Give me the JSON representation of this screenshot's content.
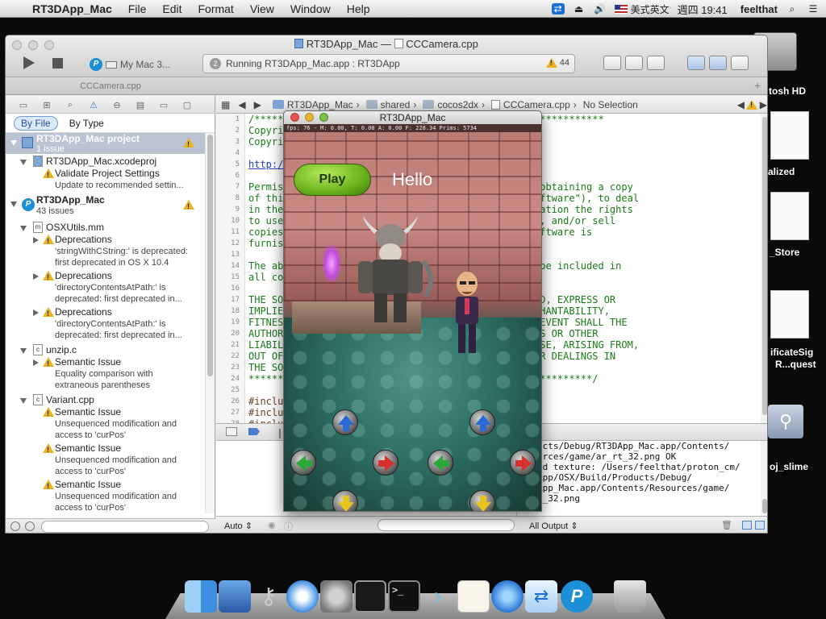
{
  "menubar": {
    "app_name": "RT3DApp_Mac",
    "menus": [
      "File",
      "Edit",
      "Format",
      "View",
      "Window",
      "Help"
    ],
    "input_method": "美式英文",
    "clock": "週四 19:41",
    "user": "feelthat"
  },
  "desktop": {
    "labels": [
      "tosh HD",
      "alized",
      "_Store",
      "ificateSig",
      "R...quest",
      "oj_slime"
    ]
  },
  "xcode": {
    "window_title": "RT3DApp_Mac",
    "window_title_sep": "—",
    "window_file": "CCCamera.cpp",
    "scheme": "My Mac 3...",
    "activity_text": "Running RT3DApp_Mac.app : RT3DApp",
    "activity_index": "2",
    "warning_count": "44",
    "tab_label": "CCCamera.cpp",
    "filter_by_file": "By File",
    "filter_by_type": "By Type",
    "jumpbar": {
      "project": "RT3DApp_Mac",
      "folder1": "shared",
      "folder2": "cocos2dx",
      "file": "CCCamera.cpp",
      "selection": "No Selection"
    },
    "issues": [
      {
        "title": "RT3DApp_Mac project",
        "sub": "1 issue"
      },
      {
        "title": "RT3DApp_Mac.xcodeproj"
      },
      {
        "title": "Validate Project Settings",
        "sub": "Update to recommended settin..."
      },
      {
        "title": "RT3DApp_Mac",
        "sub": "43 issues"
      },
      {
        "title": "OSXUtils.mm"
      },
      {
        "title": "Deprecations",
        "sub1": "'stringWithCString:' is deprecated:",
        "sub2": "first deprecated in OS X 10.4"
      },
      {
        "title": "Deprecations",
        "sub1": "'directoryContentsAtPath:' is",
        "sub2": "deprecated: first deprecated in..."
      },
      {
        "title": "Deprecations",
        "sub1": "'directoryContentsAtPath:' is",
        "sub2": "deprecated: first deprecated in..."
      },
      {
        "title": "unzip.c"
      },
      {
        "title": "Semantic Issue",
        "sub1": "Equality comparison with",
        "sub2": "extraneous parentheses"
      },
      {
        "title": "Variant.cpp"
      },
      {
        "title": "Semantic Issue",
        "sub1": "Unsequenced modification and",
        "sub2": "access to 'curPos'"
      },
      {
        "title": "Semantic Issue",
        "sub1": "Unsequenced modification and",
        "sub2": "access to 'curPos'"
      },
      {
        "title": "Semantic Issue",
        "sub1": "Unsequenced modification and",
        "sub2": "access to 'curPos'"
      }
    ],
    "line_numbers": [
      "1",
      "2",
      "3",
      "4",
      "5",
      "6",
      "7",
      "8",
      "9",
      "10",
      "11",
      "12",
      "13",
      "14",
      "15",
      "16",
      "17",
      "18",
      "19",
      "20",
      "21",
      "22",
      "23",
      "24",
      "25",
      "26",
      "27",
      "28"
    ],
    "code_lines": [
      "/************************************************************",
      "Copyri",
      "Copyri",
      "",
      "http:/",
      "",
      "Permis                                  ny person obtaining a copy",
      "of thi                                  s (the \"Software\"), to deal",
      "in the                                  hout limitation the rights",
      "to use                                  sublicense, and/or sell",
      "copies                                  hom the Software is",
      "furnis                                  tions:",
      "",
      "The ab                                  ice shall be included in",
      "all co",
      "",
      "THE SO                                  OF ANY KIND, EXPRESS OR",
      "IMPLIE                                  ES OF MERCHANTABILITY,",
      "FITNES                                  NT. IN NO EVENT SHALL THE",
      "AUTHOR                                  IM, DAMAGES OR OTHER",
      "LIABIL                                  OR OTHERWISE, ARISING FROM,",
      "OUT OF                                  SE OR OTHER DEALINGS IN",
      "THE SO",
      "***********************************************************/",
      "",
      "#inclu",
      "#inclu",
      "#inclu"
    ],
    "console_lines": [
      "ucts/Debug/RT3DApp_Mac.app/Contents/",
      "urces/game/ar_rt_32.png OK",
      "ed texture: /Users/feelthat/proton_cm/",
      "App/OSX/Build/Products/Debug/",
      "App_Mac.app/Contents/Resources/game/",
      "t_32.png"
    ],
    "status_auto": "Auto",
    "status_output": "All Output"
  },
  "game": {
    "title": "RT3DApp_Mac",
    "fps_text": "fps: 76 - M: 0.00, T: 0.00 A: 0.00 F: 228.34 Prims: 5734",
    "play_label": "Play",
    "hello_label": "Hello"
  }
}
